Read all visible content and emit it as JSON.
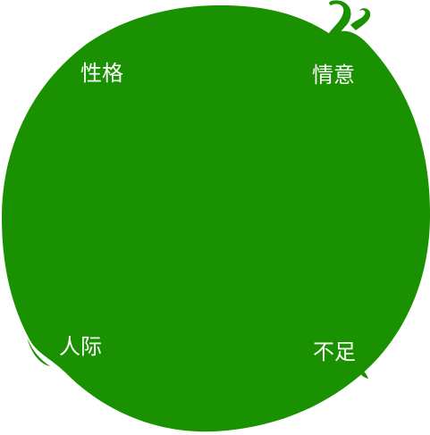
{
  "colors": {
    "fill": "#1a9100",
    "label_text": "#ffffff",
    "background": "#ffffff"
  },
  "quadrants": {
    "top_left": "性格",
    "top_right": "情意",
    "bottom_left": "人际",
    "bottom_right": "不足"
  }
}
